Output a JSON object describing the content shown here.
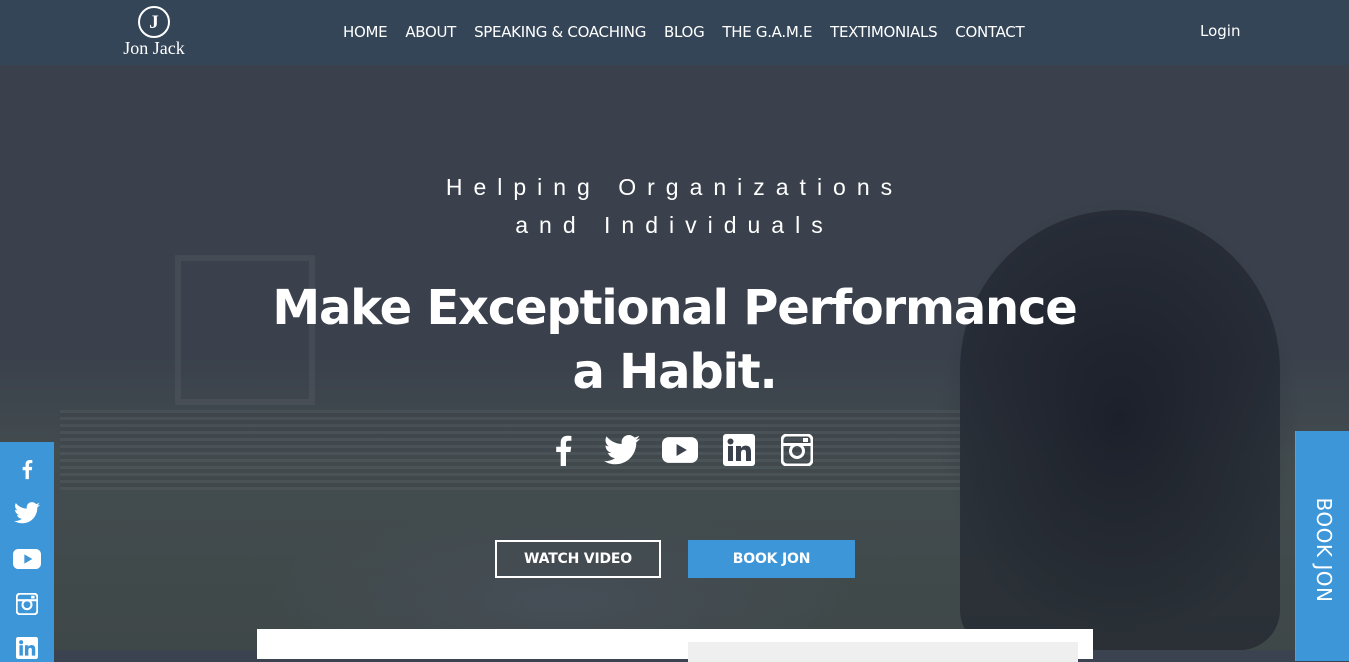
{
  "header": {
    "logo": {
      "monogram": "J",
      "name": "Jon Jack"
    },
    "nav": [
      {
        "label": "HOME"
      },
      {
        "label": "ABOUT"
      },
      {
        "label": "SPEAKING & COACHING"
      },
      {
        "label": "BLOG"
      },
      {
        "label": "THE G.A.M.E"
      },
      {
        "label": "TEXTIMONIALS"
      },
      {
        "label": "CONTACT"
      }
    ],
    "login_label": "Login"
  },
  "hero": {
    "kicker_line1": "Helping Organizations",
    "kicker_line2": "and Individuals",
    "headline_line1": "Make Exceptional Performance",
    "headline_line2": "a Habit.",
    "social_icons": [
      "facebook-icon",
      "twitter-icon",
      "youtube-icon",
      "linkedin-icon",
      "instagram-icon"
    ],
    "watch_video_label": "WATCH VIDEO",
    "book_jon_label": "BOOK JON"
  },
  "sidebar": {
    "icons": [
      "facebook-icon",
      "twitter-icon",
      "youtube-icon",
      "instagram-icon",
      "linkedin-icon"
    ]
  },
  "book_tab": {
    "label": "BOOK JON"
  },
  "colors": {
    "nav_bg": "#344558",
    "accent_blue": "#3d96d8",
    "hero_overlay": "#3a414c"
  }
}
